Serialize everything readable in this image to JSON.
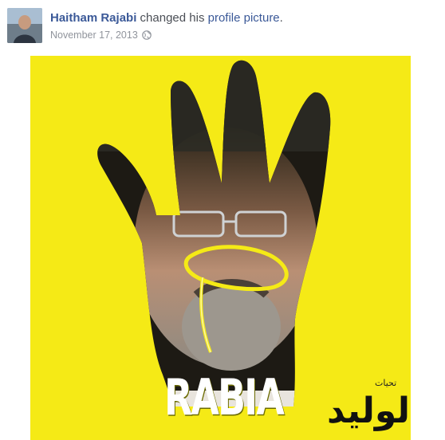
{
  "post": {
    "author_name": "Haitham Rajabi",
    "action_text": " changed his ",
    "action_link": "profile picture",
    "action_end": ".",
    "date": "November 17, 2013",
    "privacy_icon": "globe-icon"
  },
  "photo": {
    "overlay_text": "RABIA",
    "brand_text": "الوليد",
    "brand_small": "تحيات",
    "background_color": "#f5ea16",
    "link_color": "#3b5998"
  }
}
